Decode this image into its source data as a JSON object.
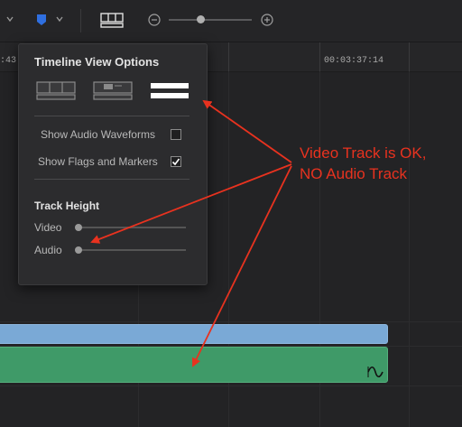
{
  "toolbar": {
    "icons": [
      "chevron-down-icon",
      "flag-icon",
      "chevron-down-icon",
      "timeline-view-options-icon",
      "zoom-out-icon",
      "zoom-slider",
      "zoom-in-icon"
    ],
    "zoom_level": 0.48
  },
  "ruler": {
    "timecode_left": ":43",
    "timecode_right": "00:03:37:14"
  },
  "popup": {
    "title": "Timeline View Options",
    "view_modes": [
      "filmstrip-view-icon",
      "thumbnail-view-icon",
      "simple-view-icon"
    ],
    "selected_view": 2,
    "options": [
      {
        "label": "Show Audio Waveforms",
        "checked": false
      },
      {
        "label": "Show Flags and Markers",
        "checked": true
      }
    ],
    "track_height": {
      "title": "Track Height",
      "video_label": "Video",
      "audio_label": "Audio",
      "video_value": 0,
      "audio_value": 0
    }
  },
  "annotation": {
    "line1": "Video Track is OK,",
    "line2": "NO Audio Track"
  },
  "colors": {
    "video_clip": "#7aa9d6",
    "audio_clip": "#3f9a68",
    "annotation": "#e8321f",
    "flag": "#2f6fe0"
  },
  "clip_icons": [
    "audio-waveform-icon"
  ]
}
